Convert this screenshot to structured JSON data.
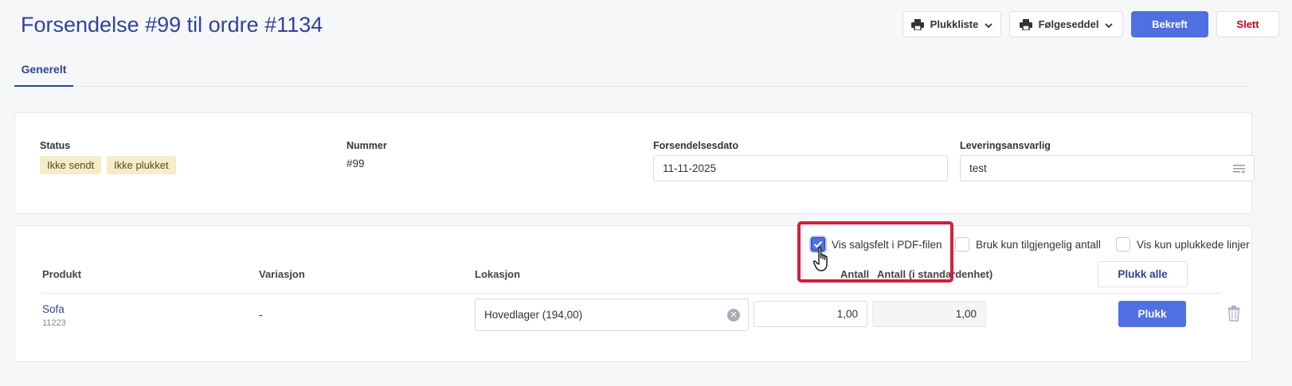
{
  "page": {
    "title": "Forsendelse #99 til ordre #1134"
  },
  "toolbar": {
    "picklist_label": "Plukkliste",
    "packing_slip_label": "Følgeseddel",
    "confirm_label": "Bekreft",
    "delete_label": "Slett"
  },
  "tabs": [
    {
      "label": "Generelt",
      "active": true
    }
  ],
  "details": {
    "status_label": "Status",
    "status_badges": [
      "Ikke sendt",
      "Ikke plukket"
    ],
    "number_label": "Nummer",
    "number_value": "#99",
    "date_label": "Forsendelsesdato",
    "date_value": "11-11-2025",
    "delivery_label": "Leveringsansvarlig",
    "delivery_value": "test"
  },
  "options": {
    "show_sales_fields": {
      "label": "Vis salgsfelt i PDF-filen",
      "checked": true
    },
    "use_available_qty": {
      "label": "Bruk kun tilgjengelig antall",
      "checked": false
    },
    "show_unpicked_only": {
      "label": "Vis kun uplukkede linjer",
      "checked": false
    }
  },
  "lines": {
    "columns": {
      "product": "Produkt",
      "variation": "Variasjon",
      "location": "Lokasjon",
      "quantity": "Antall",
      "quantity_std": "Antall (i standardenhet)"
    },
    "pick_all_label": "Plukk alle",
    "rows": [
      {
        "product_name": "Sofa",
        "sku": "11223",
        "variation": "-",
        "location": "Hovedlager (194,00)",
        "quantity": "1,00",
        "quantity_std": "1,00",
        "pick_label": "Plukk"
      }
    ]
  },
  "colors": {
    "primary": "#4f6fe3",
    "title": "#2f4496",
    "danger": "#d0021b",
    "badge_bg": "#f5ecc8",
    "highlight": "#d21f3c"
  }
}
